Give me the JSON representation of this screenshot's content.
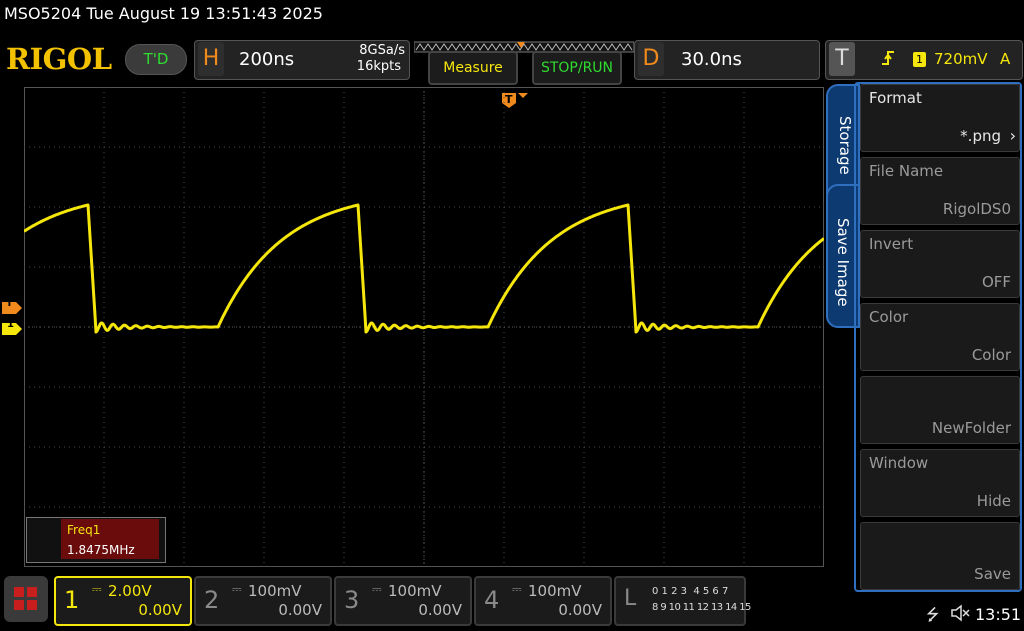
{
  "title": "MSO5204  Tue August 19 13:51:43 2025",
  "logo": "RIGOL",
  "run_mode": "T'D",
  "horizontal": {
    "key": "H",
    "timebase": "200ns",
    "sample_rate": "8GSa/s",
    "memory_depth": "16kpts"
  },
  "buttons": {
    "measure": "Measure",
    "stop_run": "STOP/RUN"
  },
  "delay": {
    "key": "D",
    "value": "30.0ns"
  },
  "trigger": {
    "key": "T",
    "channel": "1",
    "level": "720mV",
    "mode": "A",
    "marker": "T"
  },
  "markers": {
    "trig_level": "T",
    "ch1_ground": "1"
  },
  "measurement": {
    "name": "Freq1",
    "value": "1.8475MHz"
  },
  "side_tabs": {
    "storage": "Storage",
    "save_image": "Save Image"
  },
  "menu": [
    {
      "label": "Format",
      "value": "*.png"
    },
    {
      "label": "File Name",
      "value": "RigolDS0"
    },
    {
      "label": "Invert",
      "value": "OFF"
    },
    {
      "label": "Color",
      "value": "Color"
    },
    {
      "label": "",
      "value": "NewFolder"
    },
    {
      "label": "Window",
      "value": "Hide"
    },
    {
      "label": "",
      "value": "Save"
    }
  ],
  "channels": [
    {
      "num": "1",
      "scale": "2.00V",
      "offset": "0.00V",
      "color": "#f5e60c"
    },
    {
      "num": "2",
      "scale": "100mV",
      "offset": "0.00V",
      "color": "#9a9a9a"
    },
    {
      "num": "3",
      "scale": "100mV",
      "offset": "0.00V",
      "color": "#9a9a9a"
    },
    {
      "num": "4",
      "scale": "100mV",
      "offset": "0.00V",
      "color": "#9a9a9a"
    }
  ],
  "logic": {
    "key": "L",
    "row1": "0 1 2 3  4 5 6 7",
    "row2": "8 9 10 11 12 13 14 15"
  },
  "status": {
    "time": "13:51",
    "usb_icon": "usb-icon",
    "speaker_icon": "mute-icon"
  },
  "colors": {
    "ch1": "#f5e60c",
    "accent": "#f08a1c",
    "green": "#2fdc2f",
    "menu_blue": "#2f6fbf"
  }
}
